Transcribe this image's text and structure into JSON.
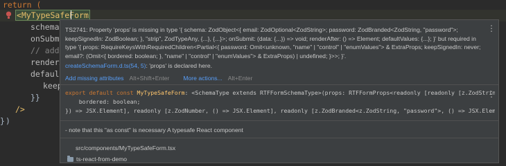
{
  "editor": {
    "lines": {
      "l1": "return (",
      "l2_tag": "MyTypeSafeForm",
      "l3": "schema={",
      "l4": "onSubmit",
      "l5": "// add t",
      "l6": "renderAf",
      "l7": "default",
      "l8": "keep",
      "l9": "}}",
      "l10": "/>",
      "l11": ")",
      "l12": "}"
    },
    "colors": {
      "background": "#2b2b2b",
      "keyword": "#cc7832",
      "tag": "#e8bf6a",
      "link": "#589df6"
    }
  },
  "popup": {
    "message": "TS2741: Property 'props' is missing in type '{ schema: ZodObject<{ email: ZodOptional<ZodString>; password: ZodBranded<ZodString, \"password\">; keepSignedIn: ZodBoolean; }, \"strip\", ZodTypeAny, {...}, {...}>; onSubmit: (data: {...}) => void; renderAfter: () => Element; defaultValues: {...}; }' but required in type '{ props: RequireKeysWithRequiredChildren<Partial<{ password: Omit<unknown, \"name\" | \"control\" | \"enumValues\"> & ExtraProps; keepSignedIn: never; email?: (Omit<{ bordered: boolean; }, \"name\" | \"control\" | \"enumValues\"> & ExtraProps) | undefined; }>>; }'.",
    "ref_link": "createSchemaForm.d.ts(54, 5)",
    "ref_text": ": 'props' is declared here.",
    "add_missing_label": "Add missing attributes",
    "add_missing_shortcut": "Alt+Shift+Enter",
    "more_actions_label": "More actions...",
    "more_actions_shortcut": "Alt+Enter",
    "declaration": {
      "line1_kw": "export default const",
      "line1_name": "MyTypeSafeForm",
      "line1_rest": ": <SchemaType extends RTFFormSchemaType>(props: RTFFormProps<readonly [readonly [z.ZodString, ({ bo",
      "line2": "    bordered: boolean;",
      "line3": "}) => JSX.Element], readonly [z.ZodNumber, () => JSX.Element], readonly [z.ZodBranded<z.ZodString, \"password\">, () => JSX.Element]], Sc"
    },
    "doc": "- note that this \"as const\" is necessary A typesafe React component",
    "location": "src/components/MyTypeSafeForm.tsx",
    "project": "ts-react-from-demo",
    "menu_icon": "⋮"
  }
}
